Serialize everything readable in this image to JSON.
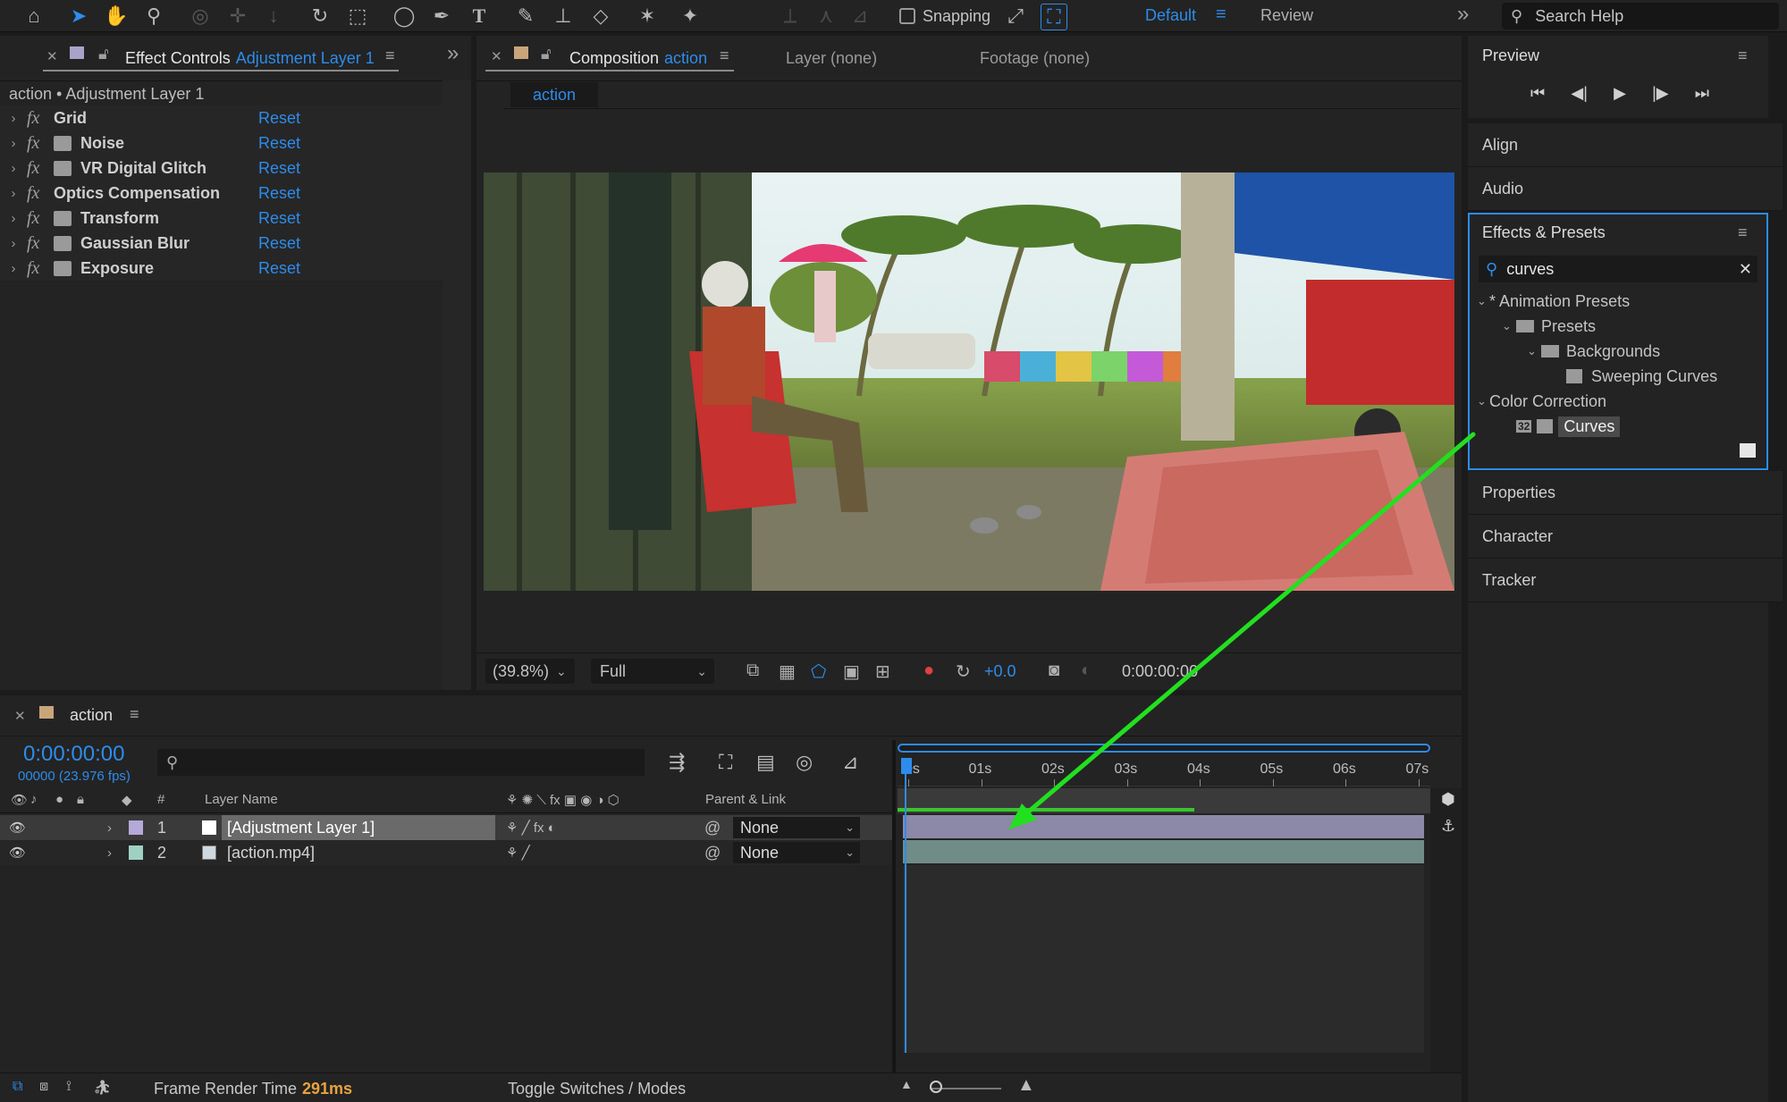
{
  "toolbar": {
    "snapping_label": "Snapping",
    "workspace_default": "Default",
    "workspace_review": "Review",
    "search_placeholder": "Search Help"
  },
  "effect_controls": {
    "tab_prefix": "Effect Controls",
    "tab_layer": "Adjustment Layer 1",
    "breadcrumb": "action • Adjustment Layer 1",
    "effects": [
      {
        "name": "Grid",
        "reset": "Reset"
      },
      {
        "name": "Noise",
        "reset": "Reset"
      },
      {
        "name": "VR Digital Glitch",
        "reset": "Reset"
      },
      {
        "name": "Optics Compensation",
        "reset": "Reset"
      },
      {
        "name": "Transform",
        "reset": "Reset"
      },
      {
        "name": "Gaussian Blur",
        "reset": "Reset"
      },
      {
        "name": "Exposure",
        "reset": "Reset"
      }
    ]
  },
  "composition": {
    "tab_prefix": "Composition",
    "tab_name": "action",
    "layer_tab": "Layer (none)",
    "footage_tab": "Footage (none)",
    "comp_subtab": "action",
    "zoom": "(39.8%)",
    "resolution": "Full",
    "exposure": "+0.0",
    "timecode": "0:00:00:00"
  },
  "right_panel": {
    "preview_title": "Preview",
    "align": "Align",
    "audio": "Audio",
    "effects_presets_title": "Effects & Presets",
    "search_value": "curves",
    "tree": {
      "animation_presets": "* Animation Presets",
      "presets": "Presets",
      "backgrounds": "Backgrounds",
      "sweeping_curves": "Sweeping Curves",
      "color_correction": "Color Correction",
      "curves": "Curves",
      "curves_badge": "32"
    },
    "properties": "Properties",
    "character": "Character",
    "tracker": "Tracker"
  },
  "timeline": {
    "tab_name": "action",
    "timecode": "0:00:00:00",
    "frames": "00000 (23.976 fps)",
    "col_number": "#",
    "col_layer_name": "Layer Name",
    "col_parent": "Parent & Link",
    "ruler": [
      "0s",
      "01s",
      "02s",
      "03s",
      "04s",
      "05s",
      "06s",
      "07s"
    ],
    "layers": [
      {
        "index": "1",
        "name": "[Adjustment Layer 1]",
        "parent": "None",
        "color": "#b4a9d8"
      },
      {
        "index": "2",
        "name": "[action.mp4]",
        "parent": "None",
        "color": "#9fd1c2"
      }
    ],
    "status_label": "Frame Render Time",
    "status_value": "291ms",
    "toggle_label": "Toggle Switches / Modes"
  },
  "colors": {
    "accent": "#2d8ceb",
    "arrow": "#22e01f",
    "adjustment_track": "#8c88a8",
    "footage_track": "#6f8c86"
  }
}
